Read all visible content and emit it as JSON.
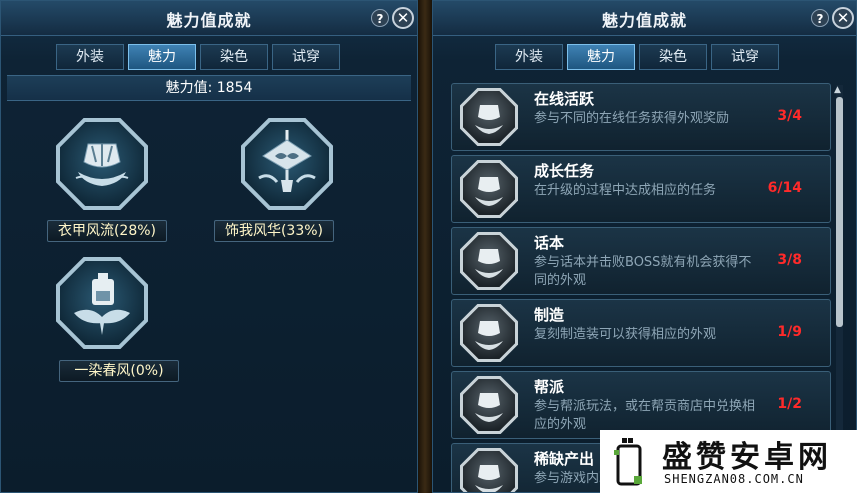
{
  "left_window": {
    "title": "魅力值成就",
    "help_label": "?",
    "close_label": "✕",
    "tabs": [
      "外装",
      "魅力",
      "染色",
      "试穿"
    ],
    "active_tab": "魅力",
    "charm_value_label": "魅力值: 1854",
    "categories": [
      {
        "label": "衣甲风流(28%)",
        "icon": "armor-category-icon"
      },
      {
        "label": "饰我风华(33%)",
        "icon": "accessory-category-icon"
      },
      {
        "label": "一染春风(0%)",
        "icon": "dye-category-icon"
      }
    ]
  },
  "right_window": {
    "title": "魅力值成就",
    "help_label": "?",
    "close_label": "✕",
    "tabs": [
      "外装",
      "魅力",
      "染色",
      "试穿"
    ],
    "active_tab": "魅力",
    "achievements": [
      {
        "name": "在线活跃",
        "desc": "参与不同的在线任务获得外观奖励",
        "progress": "3/4"
      },
      {
        "name": "成长任务",
        "desc": "在升级的过程中达成相应的任务",
        "progress": "6/14"
      },
      {
        "name": "话本",
        "desc": "参与话本并击败BOSS就有机会获得不同的外观",
        "progress": "3/8"
      },
      {
        "name": "制造",
        "desc": "复刻制造装可以获得相应的外观",
        "progress": "1/9"
      },
      {
        "name": "帮派",
        "desc": "参与帮派玩法，或在帮贡商店中兑换相应的外观",
        "progress": "1/2"
      },
      {
        "name": "稀缺产出",
        "desc": "参与游戏内耳外装",
        "progress": ""
      }
    ]
  },
  "watermark": {
    "title": "盛赞安卓网",
    "url": "SHENGZAN08.COM.CN"
  },
  "colors": {
    "progress": "#ff2a2a",
    "active_tab": "#3f82b4",
    "panel_bg": "#0e2335",
    "label_text": "#fff6c8"
  }
}
